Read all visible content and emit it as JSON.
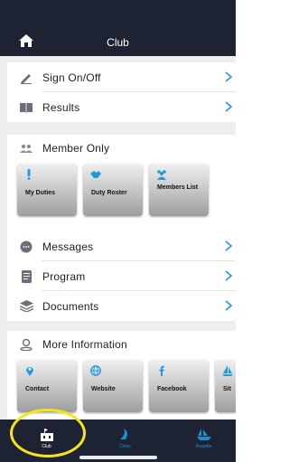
{
  "header": {
    "title": "Club"
  },
  "menu_group_1": [
    {
      "label": "Sign On/Off",
      "icon": "pencil-icon"
    },
    {
      "label": "Results",
      "icon": "book-icon"
    }
  ],
  "member_only": {
    "title": "Member Only",
    "icon": "members-icon",
    "tiles": [
      {
        "label": "My Duties",
        "icon": "exclamation-icon"
      },
      {
        "label": "Duty Roster",
        "icon": "handshake-icon"
      },
      {
        "label": "Members List",
        "icon": "people-icon"
      }
    ]
  },
  "menu_group_2": [
    {
      "label": "Messages",
      "icon": "chat-icon"
    },
    {
      "label": "Program",
      "icon": "document-icon"
    },
    {
      "label": "Documents",
      "icon": "layers-icon"
    }
  ],
  "more_information": {
    "title": "More Information",
    "icon": "person-pin-icon",
    "tiles": [
      {
        "label": "Contact",
        "icon": "location-pin-icon"
      },
      {
        "label": "Website",
        "icon": "globe-icon"
      },
      {
        "label": "Facebook",
        "icon": "facebook-icon"
      },
      {
        "label": "Sit",
        "icon": "sailboat-icon"
      }
    ]
  },
  "tabbar": {
    "tabs": [
      {
        "label": "Club",
        "icon": "club-icon",
        "selected": true
      },
      {
        "label": "Class",
        "icon": "sail-icon",
        "selected": false
      },
      {
        "label": "Regatta",
        "icon": "boat-icon",
        "selected": false
      }
    ]
  },
  "colors": {
    "header_bg": "#1d2333",
    "accent_blue": "#1e9be0",
    "tab_blue": "#1b8fd6",
    "highlight_yellow": "#f7e51b",
    "page_bg": "#eeeeee"
  }
}
